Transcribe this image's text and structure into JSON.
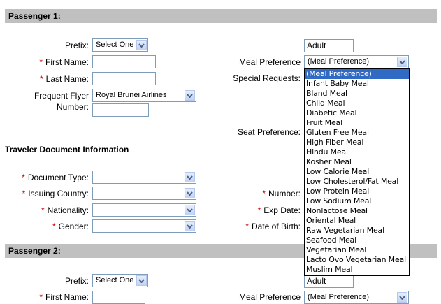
{
  "passenger1": {
    "header": "Passenger 1:",
    "prefix_label": "Prefix:",
    "prefix_value": "Select One",
    "type_value": "Adult",
    "first_name_label": "First Name:",
    "last_name_label": "Last Name:",
    "ff_label_line1": "Frequent Flyer",
    "ff_label_line2": "Number:",
    "ff_airline": "Royal Brunei Airlines",
    "meal_label": "Meal Preference",
    "meal_value": "(Meal Preference)",
    "special_requests_label": "Special Requests:",
    "seat_pref_label": "Seat Preference:",
    "travel_doc_heading": "Traveler Document Information",
    "doc_type_label": "Document Type:",
    "issuing_country_label": "Issuing Country:",
    "nationality_label": "Nationality:",
    "gender_label": "Gender:",
    "number_label": "Number:",
    "exp_date_label": "Exp Date:",
    "dob_label": "Date of Birth:"
  },
  "meal_options": [
    "(Meal Preference)",
    "Infant Baby Meal",
    "Bland Meal",
    "Child Meal",
    "Diabetic Meal",
    "Fruit Meal",
    "Gluten Free Meal",
    "High Fiber Meal",
    "Hindu Meal",
    "Kosher Meal",
    "Low Calorie Meal",
    "Low Cholesterol/Fat Meal",
    "Low Protein Meal",
    "Low Sodium Meal",
    "Nonlactose Meal",
    "Oriental Meal",
    "Raw Vegetarian Meal",
    "Seafood Meal",
    "Vegetarian Meal",
    "Lacto Ovo Vegetarian Meal",
    "Muslim Meal"
  ],
  "passenger2": {
    "header": "Passenger 2:",
    "prefix_label": "Prefix:",
    "prefix_value": "Select One",
    "type_value": "Adult",
    "first_name_label": "First Name:",
    "meal_label": "Meal Preference",
    "meal_value": "(Meal Preference)"
  },
  "required_mark": "*",
  "colors": {
    "section_bar": "#c0c0c0",
    "required": "#cc0000",
    "selection": "#316ac5",
    "input_border": "#7f9db9"
  },
  "icons": {
    "dropdown_arrow": "chevron-down-icon"
  }
}
